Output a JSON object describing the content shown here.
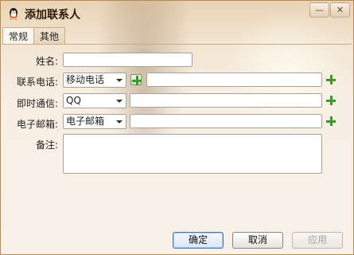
{
  "window": {
    "title": "添加联系人",
    "icon": "qq-penguin-icon"
  },
  "controls": {
    "minimize": "—",
    "close": "✕"
  },
  "tabs": [
    {
      "label": "常规"
    },
    {
      "label": "其他"
    }
  ],
  "form": {
    "name": {
      "label": "姓名:",
      "value": ""
    },
    "phone": {
      "label": "联系电话:",
      "type": "移动电话",
      "value": ""
    },
    "im": {
      "label": "即时通信:",
      "type": "QQ",
      "value": ""
    },
    "email": {
      "label": "电子邮箱:",
      "type": "电子邮箱",
      "value": ""
    },
    "note": {
      "label": "备注:",
      "value": ""
    }
  },
  "buttons": {
    "ok": "确定",
    "cancel": "取消",
    "apply": "应用"
  },
  "colors": {
    "add_green": "#3a9b2a",
    "primary_border": "#4a7ab8"
  }
}
